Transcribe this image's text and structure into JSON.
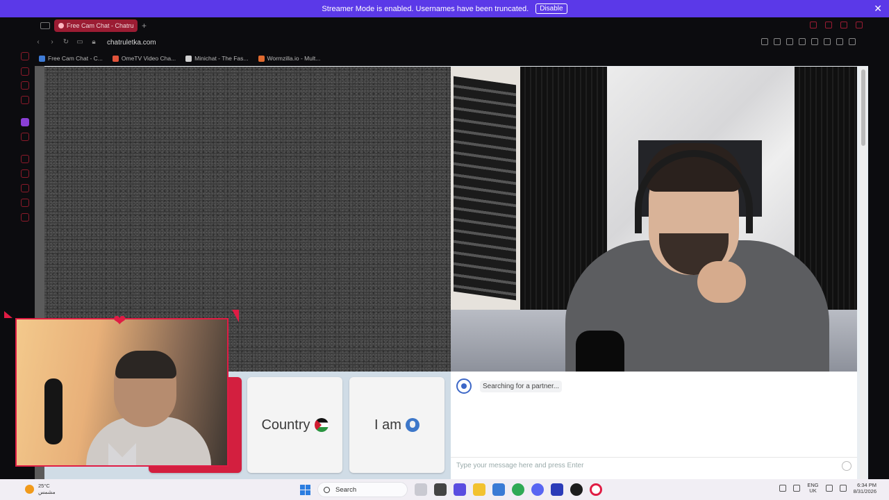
{
  "banner": {
    "message": "Streamer Mode is enabled. Usernames have been truncated.",
    "disable_label": "Disable",
    "close_glyph": "✕"
  },
  "browser": {
    "tab_title": "Free Cam Chat - Chatru",
    "new_tab_glyph": "+",
    "url": "chatruletka.com",
    "bookmarks": [
      {
        "label": "Free Cam Chat - C...",
        "color": "#3e7bd6"
      },
      {
        "label": "OmeTV Video Cha...",
        "color": "#e0533b"
      },
      {
        "label": "Minichat - The Fas...",
        "color": "#d0d0d0"
      },
      {
        "label": "Wormzilla.io - Mult...",
        "color": "#e06a2f"
      }
    ]
  },
  "controls": {
    "country_label": "Country",
    "iam_label": "I am"
  },
  "chat": {
    "status_text": "Searching for a partner...",
    "input_placeholder": "Type your message here and press Enter"
  },
  "overlay": {
    "heart_glyph": "❤"
  },
  "taskbar": {
    "temperature": "25°C",
    "weather_desc": "مشمس",
    "search_label": "Search",
    "lang_top": "ENG",
    "lang_bottom": "UK",
    "time": "6:34 PM",
    "date": "8/31/2026",
    "app_colors": [
      "#c9c9d1",
      "#444",
      "#5a4de0",
      "#f2c230",
      "#3a7bd5",
      "#2faa55",
      "#5865f2",
      "#2b3bb8",
      "#1d1d1d",
      "#e01c44"
    ]
  },
  "colors": {
    "banner": "#5b39e8",
    "accent": "#d31f3f"
  }
}
